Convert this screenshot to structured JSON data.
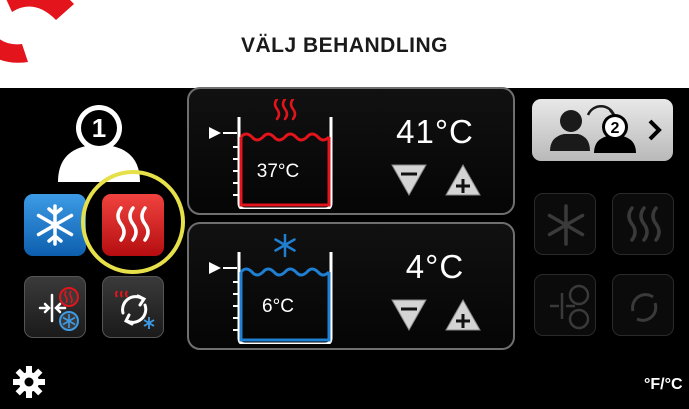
{
  "header": {
    "title": "VÄLJ BEHANDLING"
  },
  "user": {
    "number": "1"
  },
  "modes": {
    "cool_icon": "snowflake-icon",
    "heat_icon": "heat-waves-icon",
    "selected": "heat",
    "highlight_color": "#e6e04a"
  },
  "hot_tank": {
    "current_temp": "37°C",
    "setpoint": "41°C",
    "color": "#e3141b"
  },
  "cold_tank": {
    "current_temp": "6°C",
    "setpoint": "4°C",
    "color": "#1f7fd1"
  },
  "switch_user": {
    "number": "2"
  },
  "units_toggle": {
    "label": "°F/°C"
  },
  "settings": {
    "icon": "gear-icon"
  }
}
